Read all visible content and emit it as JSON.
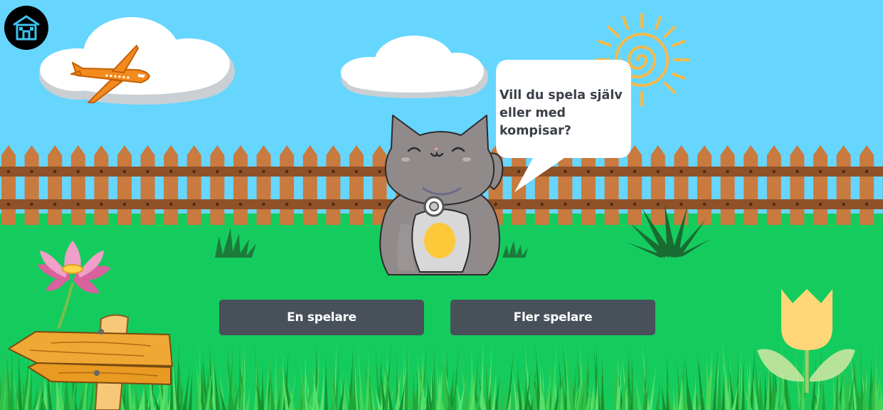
{
  "game": {
    "speech_bubble": "Vill du spela själv\neller med kompisar?",
    "buttons": {
      "single_player": "En spelare",
      "multi_player": "Fler spelare"
    }
  },
  "icons": {
    "home": "home-icon"
  },
  "colors": {
    "sky": "#66d6ff",
    "grass": "#14cc5e",
    "fence": "#c97a3f",
    "button": "#48505a",
    "button_text": "#ffffff",
    "home_icon": "#3fc3ee"
  }
}
